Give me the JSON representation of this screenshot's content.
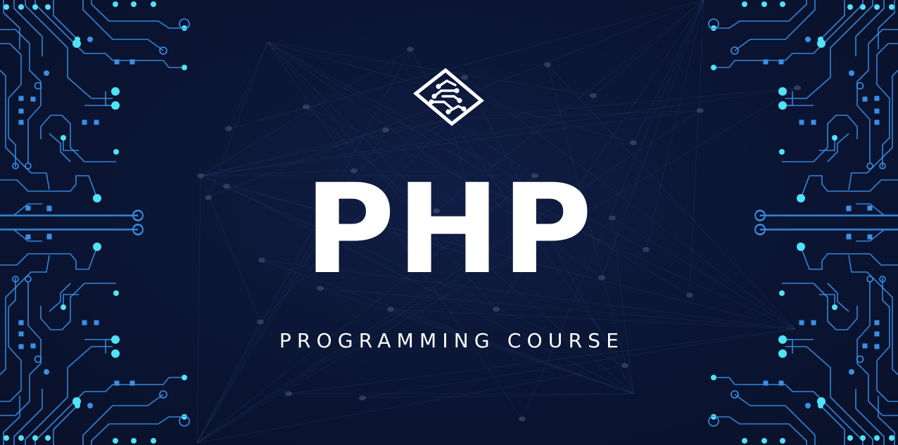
{
  "banner": {
    "title": "PHP",
    "subtitle": "PROGRAMMING COURSE"
  },
  "colors": {
    "background": "#0b1533",
    "circuit": "#3a90e8",
    "node": "#4fe3f5",
    "text": "#ffffff"
  },
  "icons": {
    "logo": "circuit-chip-icon",
    "decoration": "circuit-board-traces"
  }
}
